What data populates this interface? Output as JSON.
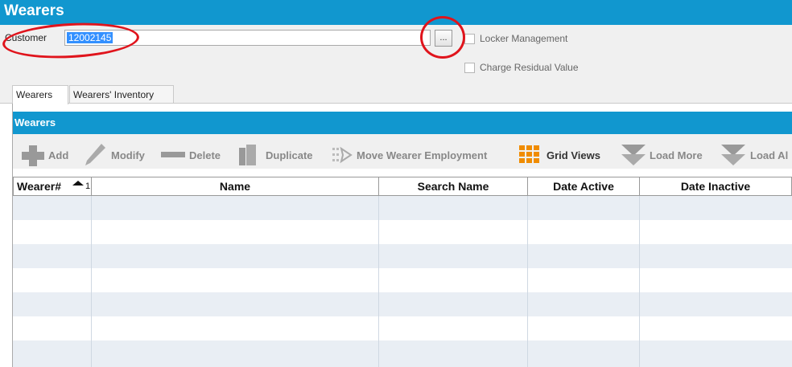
{
  "window": {
    "title": "Wearers"
  },
  "form": {
    "customer_label": "Customer",
    "customer_value": "12002145",
    "browse_label": "...",
    "locker_management_label": "Locker Management",
    "charge_residual_label": "Charge Residual Value"
  },
  "tabs": [
    {
      "label": "Wearers",
      "active": true
    },
    {
      "label": "Wearers' Inventory",
      "active": false
    }
  ],
  "section": {
    "title": "Wearers"
  },
  "toolbar": {
    "add": "Add",
    "modify": "Modify",
    "delete": "Delete",
    "duplicate": "Duplicate",
    "move": "Move Wearer Employment",
    "grid_views": "Grid Views",
    "load_more": "Load More",
    "load_all": "Load Al"
  },
  "grid": {
    "columns": [
      "Wearer#",
      "Name",
      "Search Name",
      "Date Active",
      "Date Inactive"
    ],
    "sort_indicator": "1",
    "rows": []
  },
  "colors": {
    "brand_blue": "#1197cf",
    "highlight_red": "#e0141c",
    "grid_orange": "#f08c00"
  }
}
